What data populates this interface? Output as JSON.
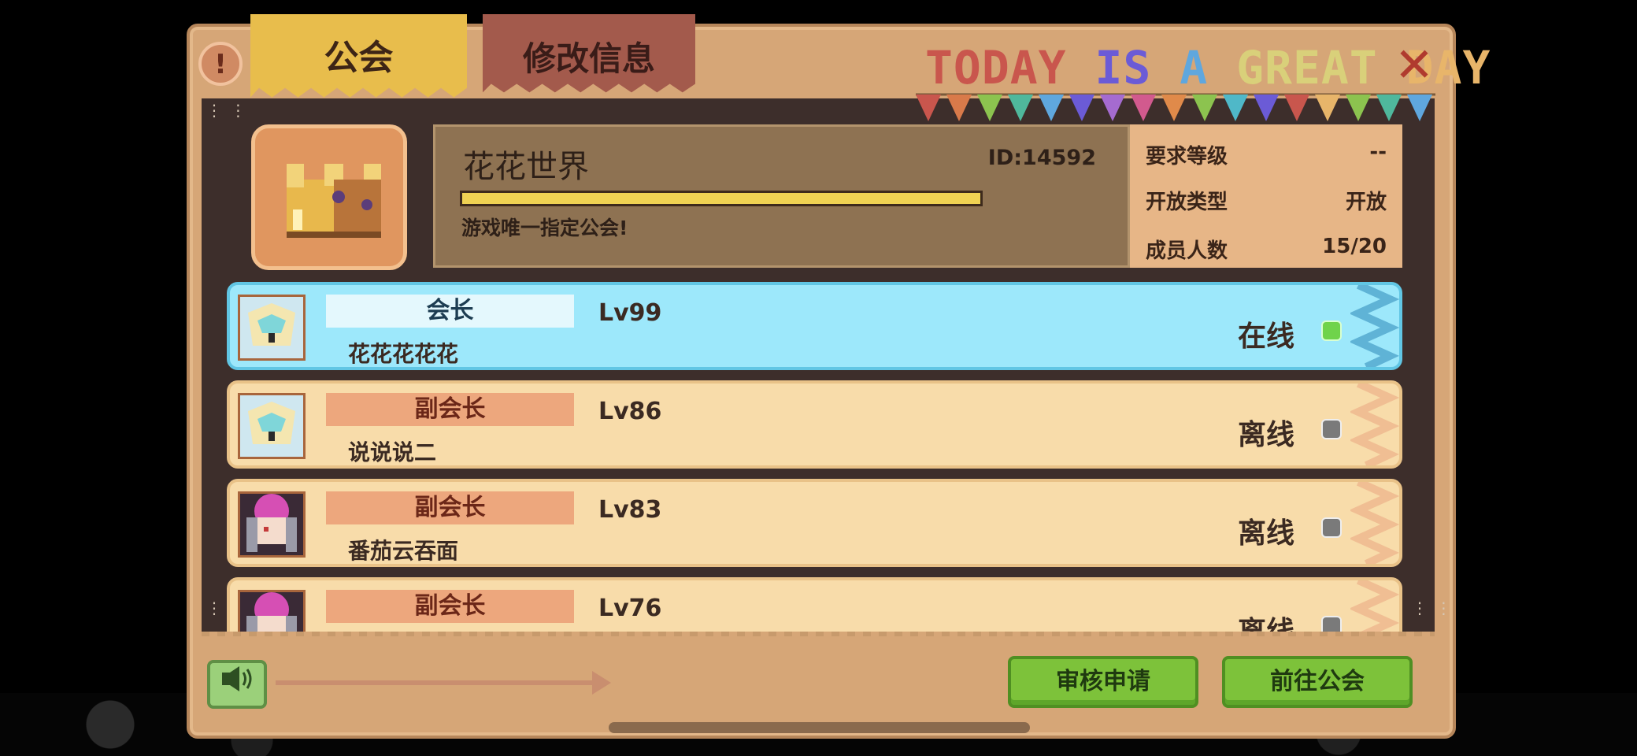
{
  "header": {
    "info_glyph": "!",
    "tabs": [
      {
        "label": "公会",
        "active": true
      },
      {
        "label": "修改信息",
        "active": false
      }
    ],
    "banner": [
      {
        "text": "TODAY",
        "color": "#c9564d"
      },
      {
        "text": "IS",
        "color": "#6b5bd6"
      },
      {
        "text": "A",
        "color": "#5fa7de"
      },
      {
        "text": "GREAT",
        "color": "#d9d07a"
      },
      {
        "text": "DAY",
        "color": "#e8b56a"
      }
    ],
    "close_glyph": "✕"
  },
  "guild": {
    "name": "花花世界",
    "id": "ID:14592",
    "exp_progress": 1.0,
    "description": "游戏唯一指定公会!",
    "stats": [
      {
        "label": "要求等级",
        "value": "--"
      },
      {
        "label": "开放类型",
        "value": "开放"
      },
      {
        "label": "成员人数",
        "value": "15/20"
      }
    ]
  },
  "members": [
    {
      "role": "会长",
      "name": "花花花花花",
      "level": "Lv99",
      "status": "在线",
      "online": true,
      "avatar": "knight-helmet-avatar"
    },
    {
      "role": "副会长",
      "name": "说说说二",
      "level": "Lv86",
      "status": "离线",
      "online": false,
      "avatar": "knight-helmet-avatar"
    },
    {
      "role": "副会长",
      "name": "番茄云吞面",
      "level": "Lv83",
      "status": "离线",
      "online": false,
      "avatar": "pink-hair-girl-avatar"
    },
    {
      "role": "副会长",
      "name": "",
      "level": "Lv76",
      "status": "离线",
      "online": false,
      "avatar": "pink-hair-girl-avatar"
    }
  ],
  "footer": {
    "sound_icon": "speaker-icon",
    "review_button": "审核申请",
    "goto_button": "前往公会"
  },
  "colors": {
    "panel": "#d6a677",
    "leader_row": "#9de8fb",
    "member_row": "#f8dcaa",
    "online_dot": "#6fd34b",
    "offline_dot": "#7a7a7a",
    "button_green": "#7dc23a"
  }
}
